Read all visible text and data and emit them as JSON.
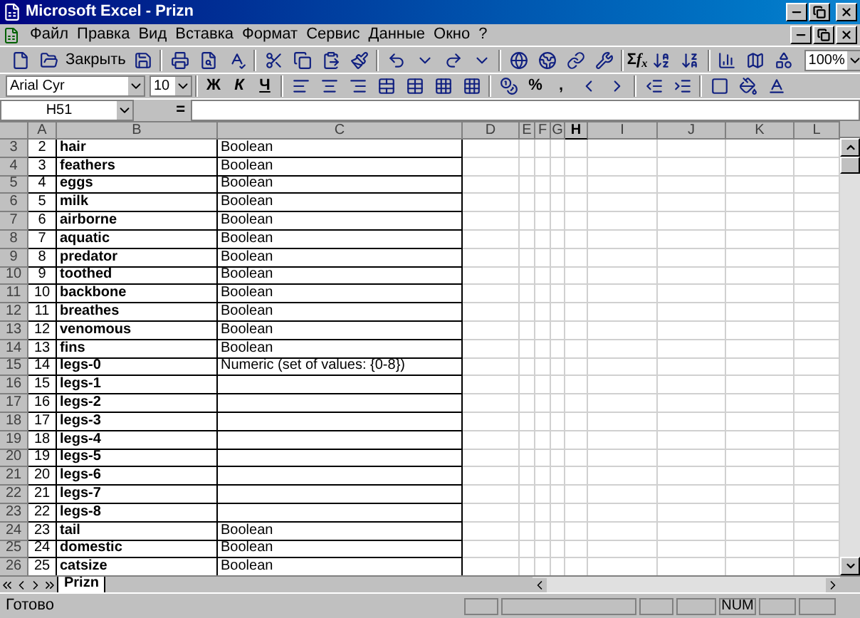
{
  "title_bar": {
    "title": "Microsoft Excel - Prizn"
  },
  "menu": [
    "Файл",
    "Правка",
    "Вид",
    "Вставка",
    "Формат",
    "Сервис",
    "Данные",
    "Окно",
    "?"
  ],
  "standard_toolbar": {
    "close_label": "Закрыть",
    "sum": "Σ",
    "function": "f$_{x}$",
    "zoom": "100%"
  },
  "format_toolbar": {
    "font": "Arial Cyr",
    "size": "10",
    "bold": "Ж",
    "italic": "К",
    "underline": "Ч",
    "percent": "%",
    "comma": ","
  },
  "formula_bar": {
    "cell_ref": "H51",
    "equals": "="
  },
  "columns": [
    {
      "label": "A",
      "selected": false
    },
    {
      "label": "B",
      "selected": false
    },
    {
      "label": "C",
      "selected": false
    },
    {
      "label": "D",
      "selected": false
    },
    {
      "label": "E",
      "selected": false
    },
    {
      "label": "F",
      "selected": false
    },
    {
      "label": "G",
      "selected": false
    },
    {
      "label": "H",
      "selected": true
    },
    {
      "label": "I",
      "selected": false
    },
    {
      "label": "J",
      "selected": false
    },
    {
      "label": "K",
      "selected": false
    },
    {
      "label": "L",
      "selected": false
    }
  ],
  "rows": [
    {
      "row": "3",
      "a": "2",
      "b": "hair",
      "c": "Boolean"
    },
    {
      "row": "4",
      "a": "3",
      "b": "feathers",
      "c": "Boolean"
    },
    {
      "row": "5",
      "a": "4",
      "b": "eggs",
      "c": "Boolean"
    },
    {
      "row": "6",
      "a": "5",
      "b": "milk",
      "c": "Boolean"
    },
    {
      "row": "7",
      "a": "6",
      "b": "airborne",
      "c": "Boolean"
    },
    {
      "row": "8",
      "a": "7",
      "b": "aquatic",
      "c": "Boolean"
    },
    {
      "row": "9",
      "a": "8",
      "b": "predator",
      "c": "Boolean"
    },
    {
      "row": "10",
      "a": "9",
      "b": "toothed",
      "c": "Boolean"
    },
    {
      "row": "11",
      "a": "10",
      "b": "backbone",
      "c": "Boolean"
    },
    {
      "row": "12",
      "a": "11",
      "b": "breathes",
      "c": "Boolean"
    },
    {
      "row": "13",
      "a": "12",
      "b": "venomous",
      "c": "Boolean"
    },
    {
      "row": "14",
      "a": "13",
      "b": "fins",
      "c": "Boolean"
    },
    {
      "row": "15",
      "a": "14",
      "b": "legs-0",
      "c": "Numeric (set of values: {0-8})"
    },
    {
      "row": "16",
      "a": "15",
      "b": "legs-1"
    },
    {
      "row": "17",
      "a": "16",
      "b": "legs-2"
    },
    {
      "row": "18",
      "a": "17",
      "b": "legs-3"
    },
    {
      "row": "19",
      "a": "18",
      "b": "legs-4"
    },
    {
      "row": "20",
      "a": "19",
      "b": "legs-5"
    },
    {
      "row": "21",
      "a": "20",
      "b": "legs-6"
    },
    {
      "row": "22",
      "a": "21",
      "b": "legs-7"
    },
    {
      "row": "23",
      "a": "22",
      "b": "legs-8"
    },
    {
      "row": "24",
      "a": "23",
      "b": "tail",
      "c": "Boolean"
    },
    {
      "row": "25",
      "a": "24",
      "b": "domestic",
      "c": "Boolean"
    },
    {
      "row": "26",
      "a": "25",
      "b": "catsize",
      "c": "Boolean"
    }
  ],
  "sheet_tabs": [
    {
      "label": "Prizn",
      "selected": true
    }
  ],
  "status_bar": {
    "text": "Готово",
    "indicators": [
      "NUM"
    ]
  }
}
